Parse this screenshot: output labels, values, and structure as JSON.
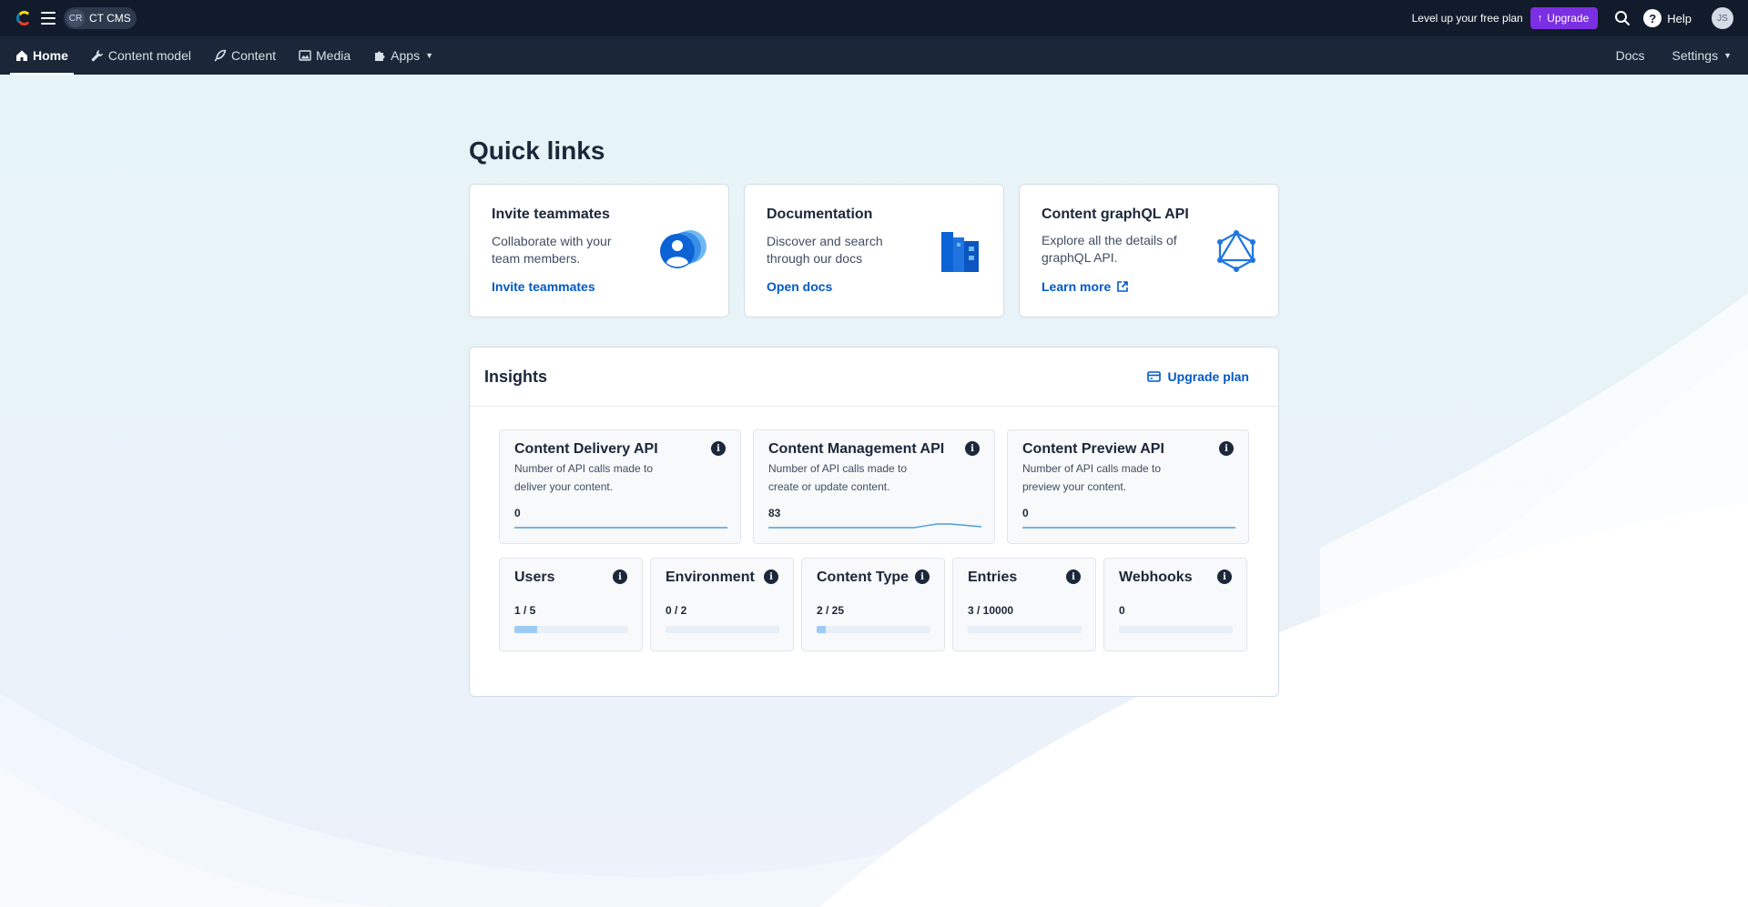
{
  "topbar": {
    "space_initials": "CR",
    "space_name": "CT CMS",
    "promo_text": "Level up your free plan",
    "upgrade_label": "Upgrade",
    "help_label": "Help",
    "user_initials": "JS"
  },
  "nav": {
    "items": [
      {
        "label": "Home",
        "icon": "home-icon"
      },
      {
        "label": "Content model",
        "icon": "wrench-icon"
      },
      {
        "label": "Content",
        "icon": "feather-icon"
      },
      {
        "label": "Media",
        "icon": "image-icon"
      },
      {
        "label": "Apps",
        "icon": "puzzle-icon"
      }
    ],
    "docs_label": "Docs",
    "settings_label": "Settings"
  },
  "quick_links": {
    "heading": "Quick links",
    "cards": [
      {
        "title": "Invite teammates",
        "description": "Collaborate with your team members.",
        "link": "Invite teammates"
      },
      {
        "title": "Documentation",
        "description": "Discover and search through our docs",
        "link": "Open docs"
      },
      {
        "title": "Content graphQL API",
        "description": "Explore all the details of graphQL API.",
        "link": "Learn more"
      }
    ]
  },
  "insights": {
    "heading": "Insights",
    "upgrade_plan": "Upgrade plan",
    "api_cards": [
      {
        "title": "Content Delivery API",
        "description": "Number of API calls made to deliver your content.",
        "value": "0"
      },
      {
        "title": "Content Management API",
        "description": "Number of API calls made to create or update content.",
        "value": "83"
      },
      {
        "title": "Content Preview API",
        "description": "Number of API calls made to preview your content.",
        "value": "0"
      }
    ],
    "usage_cards": [
      {
        "title": "Users",
        "value": "1 / 5",
        "fraction": 0.2
      },
      {
        "title": "Environment",
        "value": "0 / 2",
        "fraction": 0
      },
      {
        "title": "Content Type",
        "value": "2 / 25",
        "fraction": 0.08
      },
      {
        "title": "Entries",
        "value": "3 / 10000",
        "fraction": 0.0003
      },
      {
        "title": "Webhooks",
        "value": "0",
        "fraction": 0
      }
    ]
  },
  "colors": {
    "topbar": "#111b2b",
    "navbar": "#1b2638",
    "upgrade": "#7b2fe3",
    "link": "#0059c8",
    "bar_fill": "#9ecbf5"
  }
}
